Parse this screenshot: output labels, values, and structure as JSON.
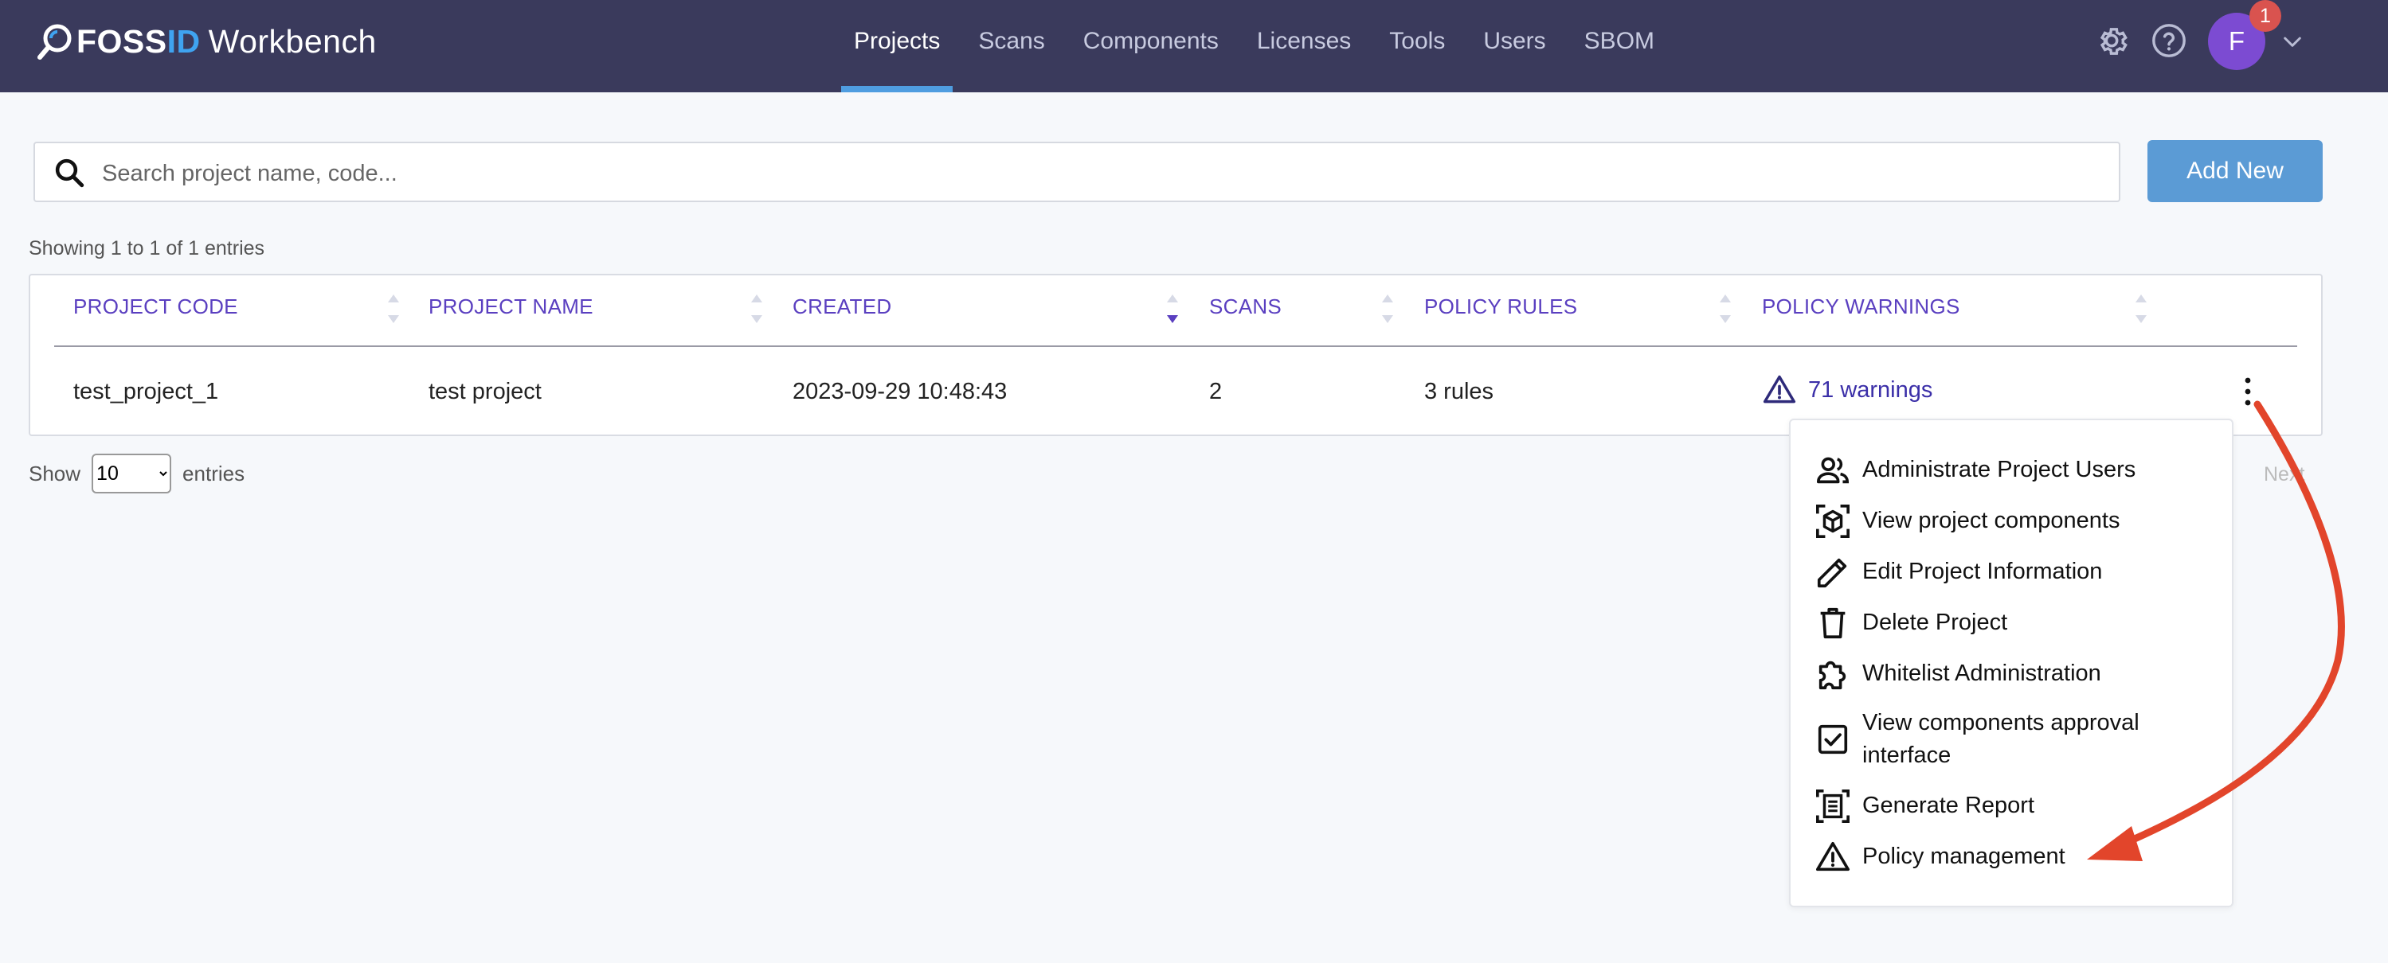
{
  "app": {
    "logo_foss": "FOSS",
    "logo_id": "ID",
    "logo_workbench": "Workbench"
  },
  "nav": {
    "items": [
      {
        "label": "Projects",
        "active": true
      },
      {
        "label": "Scans"
      },
      {
        "label": "Components"
      },
      {
        "label": "Licenses"
      },
      {
        "label": "Tools"
      },
      {
        "label": "Users"
      },
      {
        "label": "SBOM"
      }
    ]
  },
  "header": {
    "avatar_initial": "F",
    "notification_count": "1",
    "icons": [
      "gear-icon",
      "help-icon",
      "chevron-down-icon"
    ]
  },
  "search": {
    "placeholder": "Search project name, code...",
    "value": ""
  },
  "add_button": "Add New",
  "showing": "Showing 1 to 1 of 1 entries",
  "table": {
    "columns": [
      "PROJECT CODE",
      "PROJECT NAME",
      "CREATED",
      "SCANS",
      "POLICY RULES",
      "POLICY WARNINGS"
    ],
    "rows": [
      {
        "project_code": "test_project_1",
        "project_name": "test project",
        "created": "2023-09-29 10:48:43",
        "scans": "2",
        "policy_rules": "3 rules",
        "policy_warnings": "71 warnings"
      }
    ]
  },
  "pagination": {
    "show_label": "Show",
    "entries_label": "entries",
    "page_size": "10",
    "next_label": "Next"
  },
  "menu": {
    "items": [
      {
        "label": "Administrate Project Users",
        "icon": "users-icon"
      },
      {
        "label": "View project components",
        "icon": "cube-icon"
      },
      {
        "label": "Edit Project Information",
        "icon": "pencil-icon"
      },
      {
        "label": "Delete Project",
        "icon": "trash-icon"
      },
      {
        "label": "Whitelist Administration",
        "icon": "puzzle-icon"
      },
      {
        "label_line1": "View components approval",
        "label_line2": "interface",
        "icon": "checkbox-icon"
      },
      {
        "label": "Generate Report",
        "icon": "report-icon"
      },
      {
        "label": "Policy management",
        "icon": "warning-icon"
      }
    ]
  },
  "colors": {
    "topbar": "#3a3a5c",
    "accent": "#5b9bd5",
    "header_text": "#5a3fc0",
    "annotation_arrow": "#e2452b"
  }
}
